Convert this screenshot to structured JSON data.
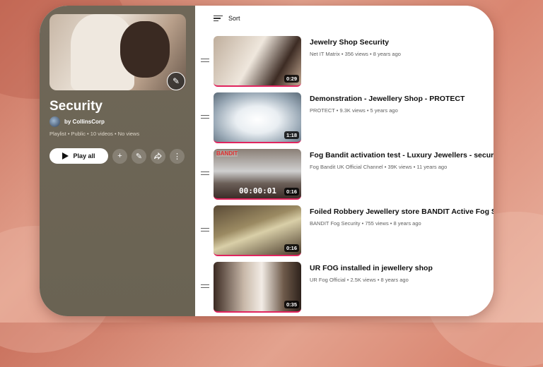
{
  "playlist": {
    "title": "Security",
    "owner": "by CollinsCorp",
    "meta": "Playlist • Public • 10 videos • No views",
    "play_all_label": "Play all"
  },
  "sort": {
    "label": "Sort"
  },
  "videos": [
    {
      "title": "Jewelry Shop Security",
      "meta": "Net IT Matrix • 356 views • 8 years ago",
      "duration": "0:29"
    },
    {
      "title": "Demonstration - Jewellery Shop - PROTECT",
      "meta": "PROTECT • 9.3K views • 5 years ago",
      "duration": "1:18"
    },
    {
      "title": "Fog Bandit activation test - Luxury Jewellers - security fog no",
      "meta": "Fog Bandit UK Official Channel • 39K views • 11 years ago",
      "duration": "0:16",
      "thumb_tag": "BANDIT",
      "thumb_clock": "00:00:01"
    },
    {
      "title": "Foiled Robbery Jewellery store BANDIT Active Fog Security",
      "meta": "BANDIT Fog Security • 755 views • 8 years ago",
      "duration": "0:16"
    },
    {
      "title": "UR FOG installed in jewellery shop",
      "meta": "UR Fog Official • 2.5K views • 8 years ago",
      "duration": "0:35"
    }
  ],
  "icons": {
    "edit": "pencil-icon",
    "play": "play-icon",
    "add": "plus-icon",
    "share": "share-icon",
    "more": "more-vertical-icon",
    "sort": "sort-icon",
    "drag": "drag-handle-icon"
  }
}
